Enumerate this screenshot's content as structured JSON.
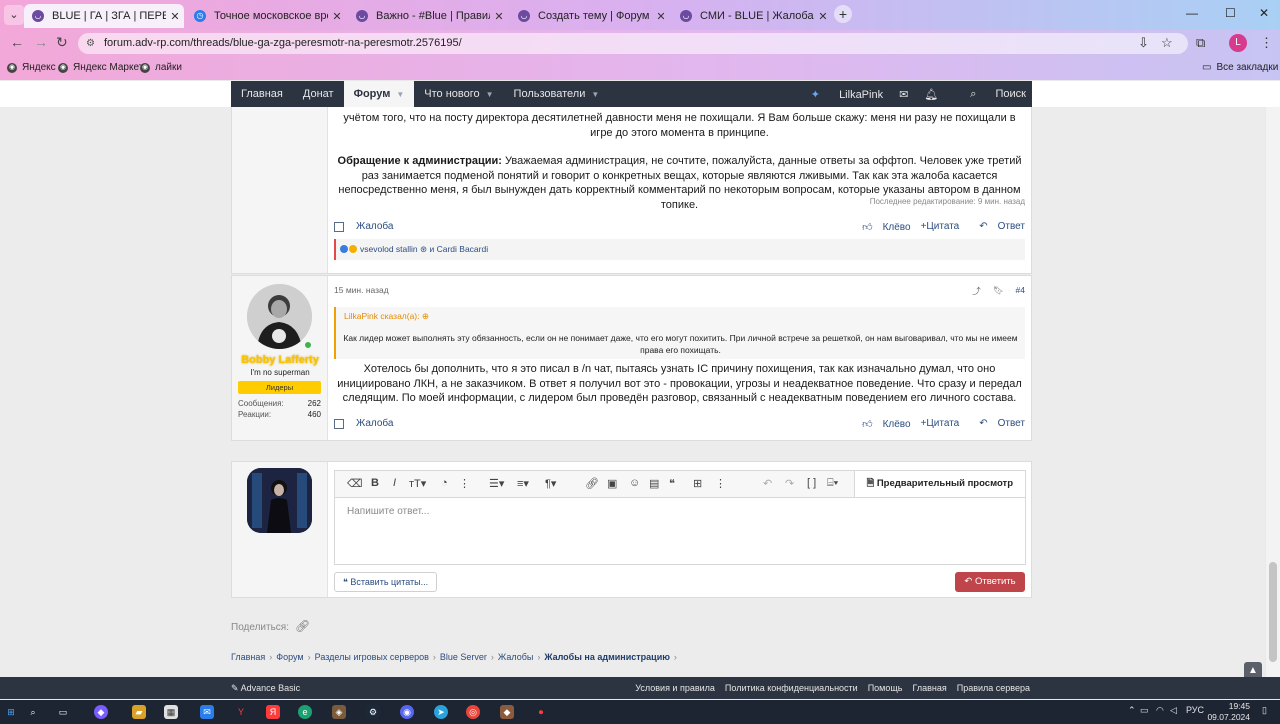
{
  "browser": {
    "tabs": [
      {
        "title": "BLUE | ГА | ЗГА | ПЕРЕСМОТР Н",
        "active": true
      },
      {
        "title": "Точное московское время",
        "active": false
      },
      {
        "title": "Важно - #Blue | Правила подз",
        "active": false
      },
      {
        "title": "Создать тему | Форум Advance",
        "active": false
      },
      {
        "title": "СМИ - BLUE | Жалоба на дирек",
        "active": false
      }
    ],
    "url": "forum.adv-rp.com/threads/blue-ga-zga-peresmotr-na-peresmotr.2576195/",
    "profile_letter": "L",
    "bookmarks": [
      "Яндекс",
      "Яндекс Маркет",
      "лайки"
    ],
    "all_bookmarks": "Все закладки"
  },
  "nav": {
    "items": [
      "Главная",
      "Донат",
      "Форум",
      "Что нового",
      "Пользователи"
    ],
    "username": "LilkaPink",
    "search": "Поиск"
  },
  "post1": {
    "line_top": "учётом того, что на посту директора десятилетней давности меня не похищали. Я Вам больше скажу: меня ни разу не похищали в игре до этого момента в принципе.",
    "appeal_bold": "Обращение к администрации:",
    "appeal_text": " Уважаемая администрация, не сочтите, пожалуйста, данные ответы за оффтоп. Человек уже третий раз занимается подменой понятий и говорит о конкретных вещах, которые являются лживыми. Так как эта жалоба касается непосредственно меня, я был вынужден дать корректный комментарий по некоторым вопросам, которые указаны автором в данном топике.",
    "edited": "Последнее редактирование: 9 мин. назад",
    "report": "Жалоба",
    "like": "Клёво",
    "quote": "+Цитата",
    "reply": "Ответ",
    "reactions": "vsevolod stallin ⊛ и Cardi Bacardi"
  },
  "post2": {
    "author": "Bobby Lafferty",
    "user_title": "I'm no superman",
    "banner": "Лидеры",
    "stats": [
      {
        "label": "Сообщения:",
        "value": "262"
      },
      {
        "label": "Реакции:",
        "value": "460"
      }
    ],
    "time": "15 мин. назад",
    "number": "#4",
    "quote_author": "LilkaPink сказал(а):",
    "quote_text": "Как лидер может выполнять эту обязанность, если он не понимает даже, что его могут похитить. При личной встрече за решеткой, он нам выговаривал, что мы не имеем права его похищать.",
    "body": "Хотелось бы дополнить, что я это писал в /n чат, пытаясь узнать IC причину похищения, так как изначально думал, что оно инициировано ЛКН, а не заказчиком. В ответ я получил вот это - провокации, угрозы и неадекватное поведение. Что сразу и передал следящим. По моей информации, с лидером был проведён разговор, связанный с неадекватным поведением его личного состава.",
    "report": "Жалоба",
    "like": "Клёво",
    "quote": "+Цитата",
    "reply": "Ответ"
  },
  "editor": {
    "preview": "Предварительный просмотр",
    "placeholder": "Напишите ответ...",
    "insert_quotes": "Вставить цитаты...",
    "reply_button": "Ответить"
  },
  "share_label": "Поделиться:",
  "breadcrumbs": [
    "Главная",
    "Форум",
    "Разделы игровых серверов",
    "Blue Server",
    "Жалобы",
    "Жалобы на администрацию"
  ],
  "footer": {
    "style": "Advance Basic",
    "links": [
      "Условия и правила",
      "Политика конфиденциальности",
      "Помощь",
      "Главная",
      "Правила сервера"
    ]
  },
  "taskbar": {
    "lang": "РУС",
    "time": "19:45",
    "date": "09.07.2024"
  }
}
